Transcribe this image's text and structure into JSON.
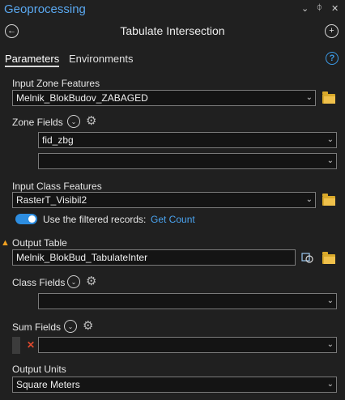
{
  "pane": {
    "title": "Geoprocessing",
    "controls": {
      "options": "⌄",
      "pin": "ᛰ",
      "close": "✕"
    }
  },
  "tool": {
    "title": "Tabulate Intersection",
    "back_icon": "←",
    "add_icon": "+"
  },
  "tabs": {
    "parameters": "Parameters",
    "environments": "Environments",
    "help_icon": "?"
  },
  "params": {
    "input_zone": {
      "label": "Input Zone Features",
      "value": "Melnik_BlokBudov_ZABAGED"
    },
    "zone_fields": {
      "label": "Zone Fields",
      "rows": [
        "fid_zbg",
        ""
      ]
    },
    "input_class": {
      "label": "Input Class Features",
      "value": "RasterT_Visibil2"
    },
    "filter": {
      "label": "Use the filtered records:",
      "link": "Get Count",
      "on": true
    },
    "output_table": {
      "label": "Output Table",
      "value": "Melnik_BlokBud_TabulateInter"
    },
    "class_fields": {
      "label": "Class Fields",
      "value": ""
    },
    "sum_fields": {
      "label": "Sum Fields",
      "value": ""
    },
    "output_units": {
      "label": "Output Units",
      "value": "Square Meters"
    }
  },
  "glyphs": {
    "chevron": "⌄",
    "gear": "⚙",
    "small_chevron": "⌄",
    "warning": "▲",
    "x": "✕"
  },
  "colors": {
    "background": "#202020",
    "accent": "#4aa3ef",
    "folder": "#f0c14b",
    "warning": "#f0a020",
    "error": "#e0492d"
  }
}
